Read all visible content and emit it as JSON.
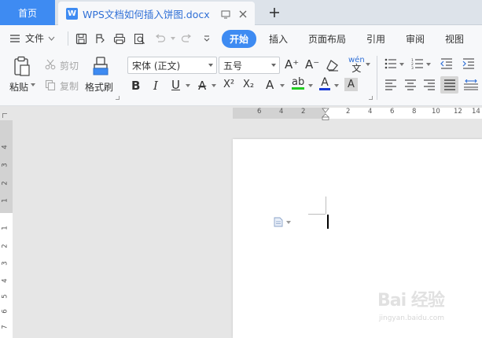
{
  "tabs": {
    "home_label": "首页",
    "doc_title": "WPS文档如何插入饼图.docx",
    "wps_glyph": "W"
  },
  "menu": {
    "file_label": "文件",
    "tabs": [
      "开始",
      "插入",
      "页面布局",
      "引用",
      "审阅",
      "视图"
    ],
    "active_tab": "开始"
  },
  "ribbon": {
    "paste_label": "粘贴",
    "cut_label": "剪切",
    "copy_label": "复制",
    "format_painter_label": "格式刷",
    "font_name": "宋体 (正文)",
    "font_size": "五号",
    "pinyin_glyph": "wén",
    "bold_glyph": "B",
    "italic_glyph": "I",
    "underline_glyph": "U",
    "strike_glyph": "A",
    "superscript_glyph": "X²",
    "subscript_glyph": "X₂",
    "effect_glyph": "A",
    "highlight_glyph": "ab",
    "font_color_glyph": "A",
    "char_shade_glyph": "A",
    "grow_glyph": "A⁺",
    "shrink_glyph": "A⁻",
    "highlight_color": "#22cc22",
    "font_color": "#1a3bd6"
  },
  "ruler": {
    "horizontal_numbers": [
      "6",
      "4",
      "2",
      "2",
      "4",
      "6",
      "8",
      "10",
      "12",
      "14"
    ],
    "vertical_numbers": [
      "4",
      "3",
      "2",
      "1",
      "1",
      "2",
      "3",
      "4",
      "5",
      "6",
      "7"
    ]
  },
  "watermark": {
    "text": "Bai 经验",
    "url": "jingyan.baidu.com"
  },
  "colors": {
    "accent": "#3e8bf2",
    "tab_bar": "#dde3ea",
    "ribbon_bg": "#f7f8fa",
    "canvas_bg": "#e6e6e6"
  }
}
